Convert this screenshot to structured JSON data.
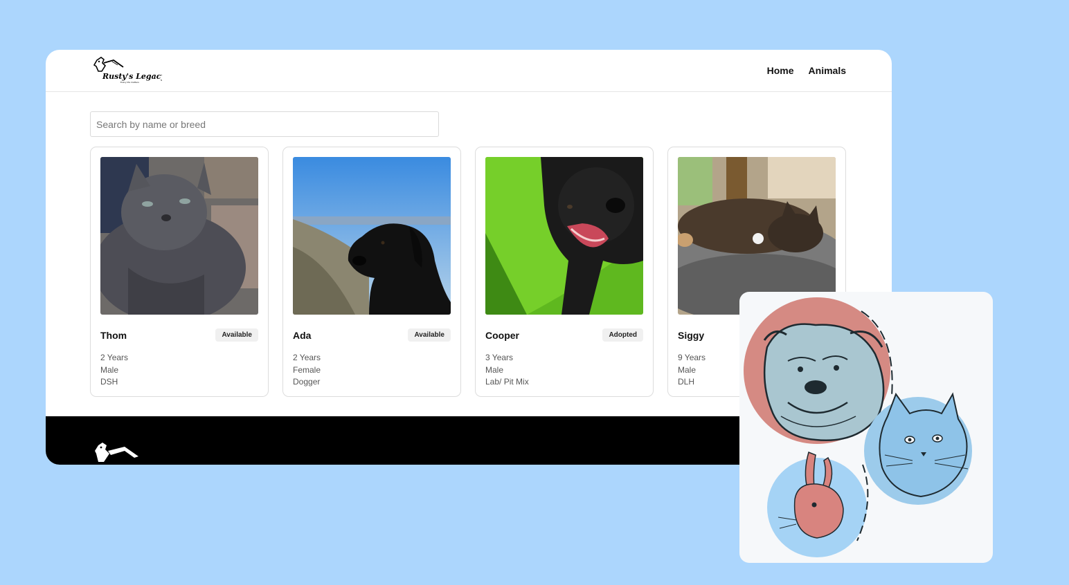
{
  "brand": {
    "name": "Rusty's Legacy",
    "tagline": "Every life matters"
  },
  "nav": {
    "items": [
      "Home",
      "Animals"
    ]
  },
  "search": {
    "placeholder": "Search by name or breed",
    "value": ""
  },
  "animals": [
    {
      "name": "Thom",
      "status": "Available",
      "age": "2 Years",
      "sex": "Male",
      "breed": "DSH",
      "photo_icon": "gray-cat-photo"
    },
    {
      "name": "Ada",
      "status": "Available",
      "age": "2 Years",
      "sex": "Female",
      "breed": "Dogger",
      "photo_icon": "black-dog-photo"
    },
    {
      "name": "Cooper",
      "status": "Adopted",
      "age": "3 Years",
      "sex": "Male",
      "breed": "Lab/ Pit Mix",
      "photo_icon": "black-dog-on-grass-photo"
    },
    {
      "name": "Siggy",
      "status": "",
      "age": "9 Years",
      "sex": "Male",
      "breed": "DLH",
      "photo_icon": "tabby-cat-photo"
    }
  ],
  "colors": {
    "background": "#acd6fd",
    "footer": "#000000",
    "badge": "#f0f0f0"
  }
}
